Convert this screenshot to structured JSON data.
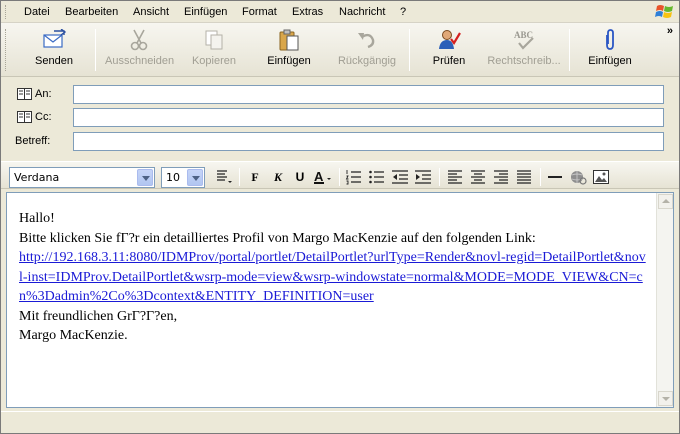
{
  "menubar": {
    "items": [
      {
        "label": "Datei"
      },
      {
        "label": "Bearbeiten"
      },
      {
        "label": "Ansicht"
      },
      {
        "label": "Einfügen"
      },
      {
        "label": "Format"
      },
      {
        "label": "Extras"
      },
      {
        "label": "Nachricht"
      },
      {
        "label": "?"
      }
    ]
  },
  "toolbar": {
    "send_label": "Senden",
    "cut_label": "Ausschneiden",
    "copy_label": "Kopieren",
    "paste_label": "Einfügen",
    "undo_label": "Rückgängig",
    "check_label": "Prüfen",
    "spelling_label": "Rechtschreib...",
    "attach_label": "Einfügen",
    "more_glyph": "»"
  },
  "header": {
    "to_label": "An:",
    "cc_label": "Cc:",
    "subject_label": "Betreff:",
    "to_value": "",
    "cc_value": "",
    "subject_value": ""
  },
  "formatbar": {
    "font_name": "Verdana",
    "font_size": "10",
    "bold_glyph": "F",
    "italic_glyph": "K",
    "underline_glyph": "U"
  },
  "message": {
    "greeting": "Hallo!",
    "line1": "Bitte klicken Sie fГ?r ein detailliertes Profil von Margo MacKenzie auf den folgenden Link:",
    "link": "http://192.168.3.11:8080/IDMProv/portal/portlet/DetailPortlet?urlType=Render&novl-regid=DetailPortlet&novl-inst=IDMProv.DetailPortlet&wsrp-mode=view&wsrp-windowstate=normal&MODE=MODE_VIEW&CN=cn%3Dadmin%2Co%3Dcontext&ENTITY_DEFINITION=user",
    "closing": "Mit freundlichen GrГ?Г?en,",
    "signature": "Margo MacKenzie."
  },
  "colors": {
    "link": "#1a1ad6",
    "chrome": "#ece9d8",
    "input_border": "#7f9db9"
  }
}
